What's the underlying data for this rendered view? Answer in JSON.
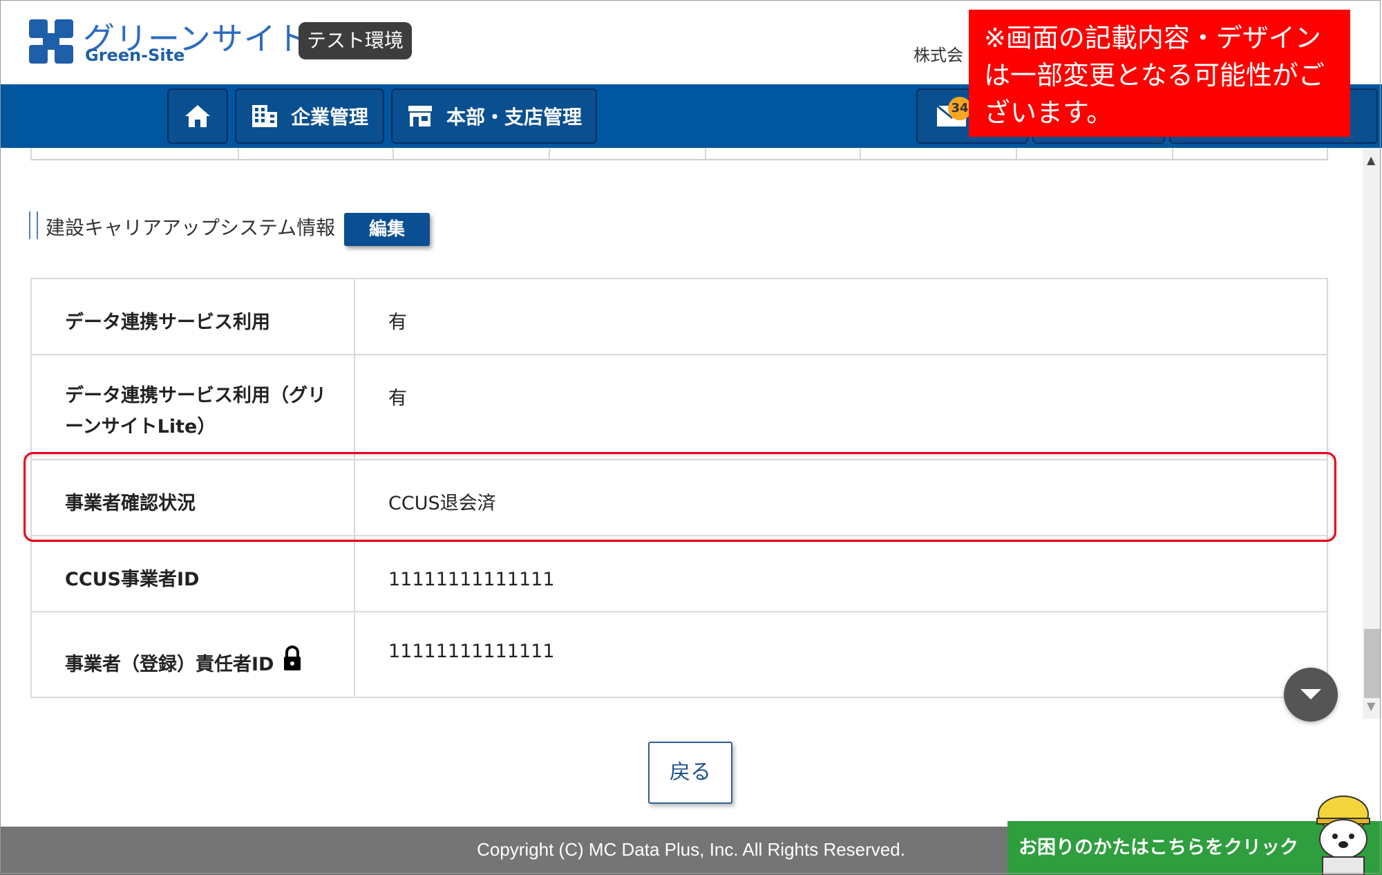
{
  "header": {
    "logo_title": "グリーンサイト",
    "logo_subtitle": "Green-Site",
    "env_badge": "テスト環境",
    "company_partial": "株式会"
  },
  "nav": {
    "home_icon": "home-icon",
    "company_label": "企業管理",
    "branch_label": "本部・支店管理",
    "mail_count": "34"
  },
  "notice": {
    "text": "※画面の記載内容・デザインは一部変更となる可能性がございます。"
  },
  "section": {
    "title": "建設キャリアアップシステム情報",
    "edit_label": "編集"
  },
  "table": {
    "rows": [
      {
        "label": "データ連携サービス利用",
        "value": "有"
      },
      {
        "label": "データ連携サービス利用（グリーンサイトLite）",
        "value": "有"
      },
      {
        "label": "事業者確認状況",
        "value": "CCUS退会済"
      },
      {
        "label": "CCUS事業者ID",
        "value": "11111111111111"
      },
      {
        "label": "事業者（登録）責任者ID",
        "value": "11111111111111"
      }
    ]
  },
  "actions": {
    "back_label": "戻る"
  },
  "footer": {
    "copyright": "Copyright (C) MC Data Plus, Inc. All Rights Reserved.",
    "help_label": "お困りのかたはこちらをクリック"
  },
  "colors": {
    "nav_blue": "#0057a0",
    "notice_red": "#ff0000",
    "highlight_red": "#e8001c",
    "help_green": "#2e9e3e"
  }
}
